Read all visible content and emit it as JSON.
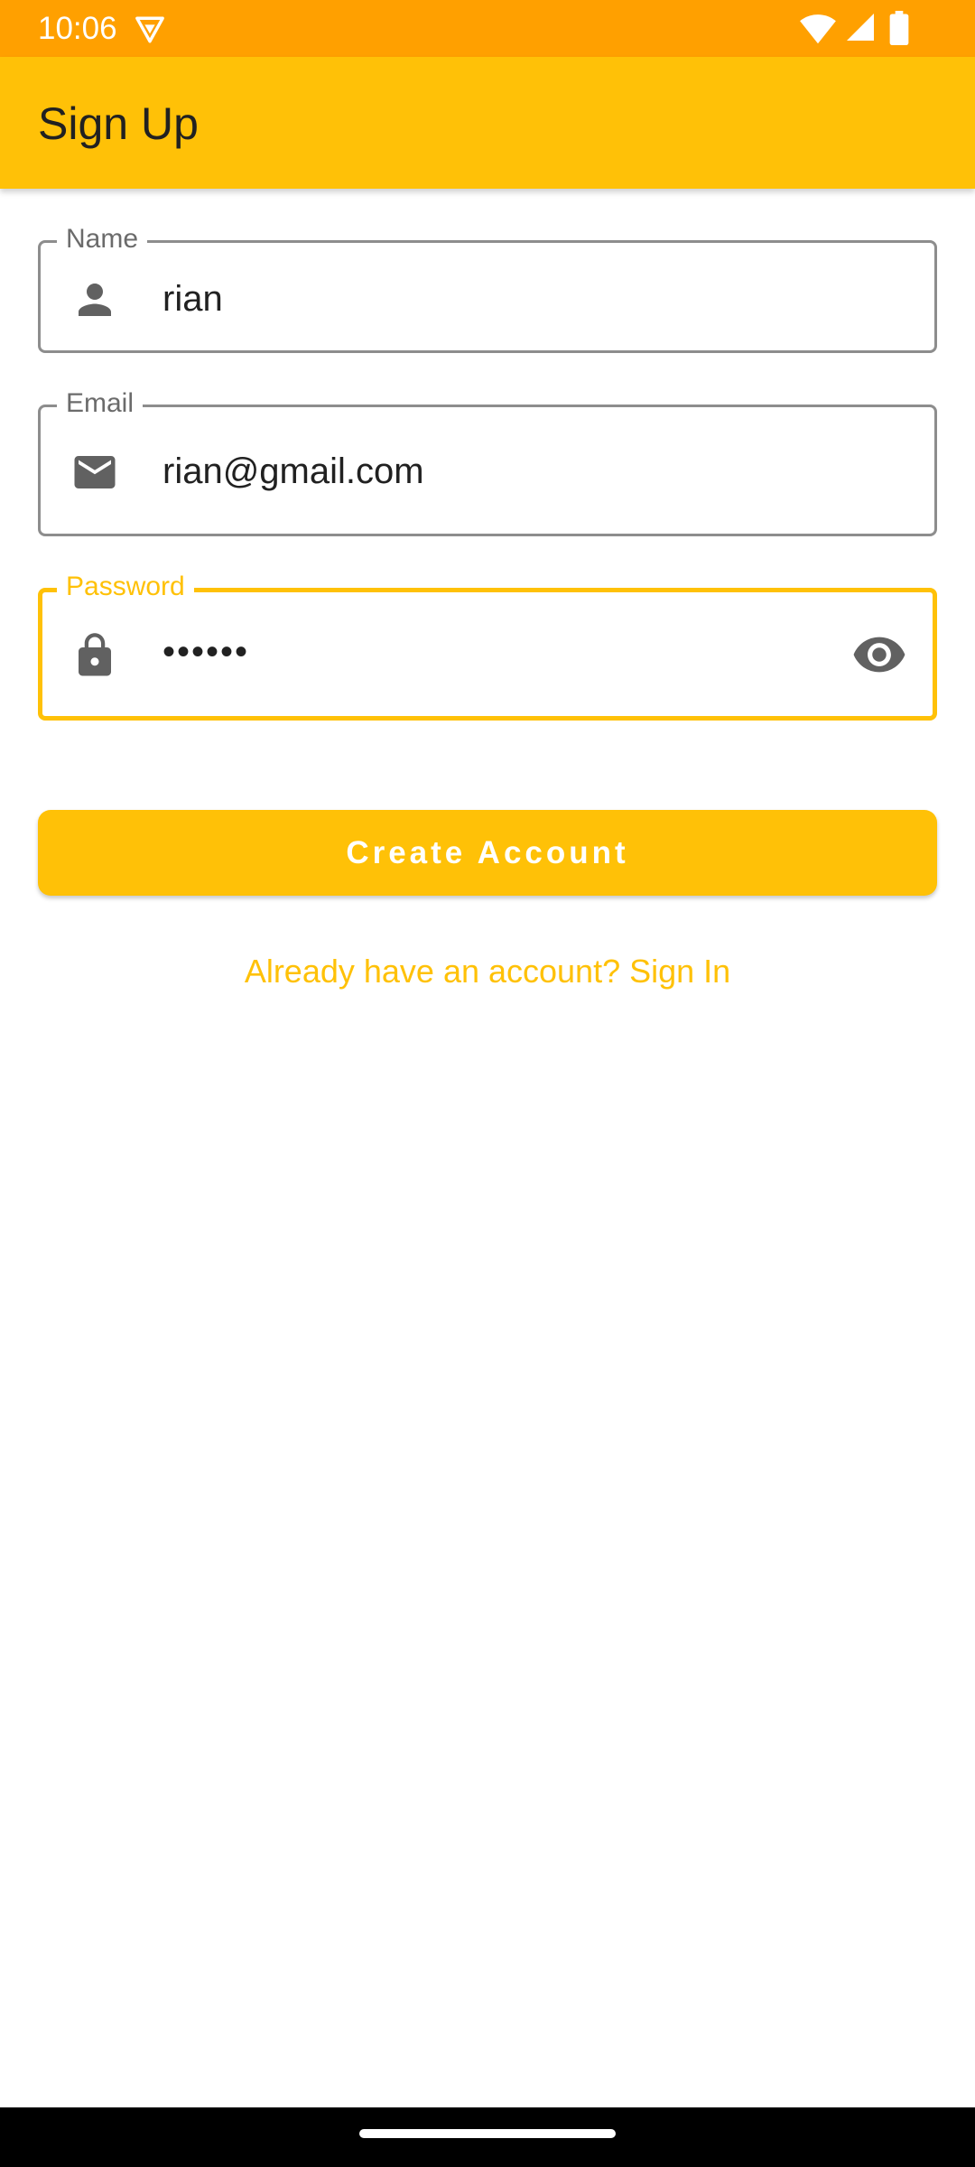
{
  "status_bar": {
    "time": "10:06",
    "background": "#FFA000"
  },
  "app_bar": {
    "title": "Sign Up",
    "background": "#FFC107"
  },
  "form": {
    "name": {
      "label": "Name",
      "value": "rian",
      "icon": "person-icon"
    },
    "email": {
      "label": "Email",
      "value": "rian@gmail.com",
      "icon": "email-icon"
    },
    "password": {
      "label": "Password",
      "value": "••••••",
      "icon": "lock-icon",
      "trailing_icon": "eye-icon",
      "focused": true
    }
  },
  "actions": {
    "create_account_label": "Create Account",
    "sign_in_link": "Already have an account? Sign In"
  },
  "colors": {
    "accent": "#FFC107",
    "status_bar": "#FFA000",
    "outline": "#8d8d8d",
    "icon": "#616161"
  }
}
